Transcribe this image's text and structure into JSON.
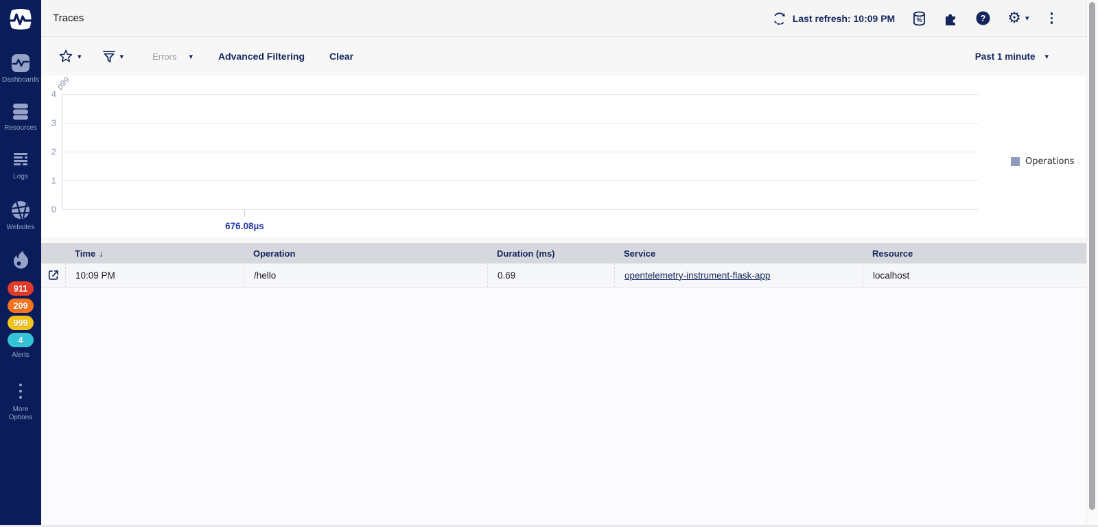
{
  "colors": {
    "sidebar_bg": "#0a1d5a",
    "sidebar_icon": "#96a3c8",
    "accent_navy": "#14265c",
    "table_header_bg": "#d6d8de",
    "xtick_label": "#2838a8"
  },
  "sidebar": {
    "items": [
      {
        "label": "Dashboards"
      },
      {
        "label": "Resources"
      },
      {
        "label": "Logs"
      },
      {
        "label": "Websites"
      }
    ],
    "alerts": {
      "label": "Alerts",
      "badges": [
        {
          "value": "911",
          "color": "#e23a28"
        },
        {
          "value": "209",
          "color": "#f4731d"
        },
        {
          "value": "999",
          "color": "#f2c51d"
        },
        {
          "value": "4",
          "color": "#35c3d6"
        }
      ]
    },
    "more_options_label": "More Options"
  },
  "header": {
    "title": "Traces",
    "last_refresh": "Last refresh: 10:09 PM"
  },
  "toolbar": {
    "errors_label": "Errors",
    "advanced_filtering_label": "Advanced Filtering",
    "clear_label": "Clear",
    "time_range": "Past 1 minute"
  },
  "chart_data": {
    "type": "line",
    "title": "",
    "ylabel": "p99",
    "ylim": [
      0,
      4
    ],
    "yticks": [
      0,
      1,
      2,
      3,
      4
    ],
    "xticks": [
      {
        "label": "676.08µs",
        "position_fraction": 0.199
      }
    ],
    "series": [
      {
        "name": "Operations",
        "values": [],
        "color": "#8f9cbd"
      }
    ],
    "grid": true,
    "legend_position": "right"
  },
  "table": {
    "columns": [
      {
        "label": "Time",
        "sort": "desc"
      },
      {
        "label": "Operation"
      },
      {
        "label": "Duration (ms)"
      },
      {
        "label": "Service"
      },
      {
        "label": "Resource"
      }
    ],
    "rows": [
      {
        "time": "10:09 PM",
        "operation": "/hello",
        "duration_ms": "0.69",
        "service": "opentelemetry-instrument-flask-app",
        "resource": "localhost"
      }
    ]
  }
}
